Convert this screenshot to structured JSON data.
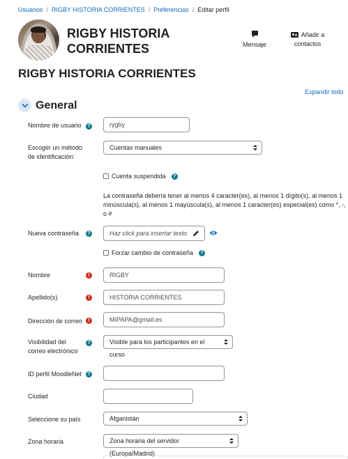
{
  "breadcrumb": [
    {
      "label": "Usuarios"
    },
    {
      "label": "RIGBY HISTORIA CORRIENTES"
    },
    {
      "label": "Preferencias"
    },
    {
      "label": "Editar perfil"
    }
  ],
  "breadcrumb_sep": "/",
  "header": {
    "name": "RIGBY HISTORIA CORRIENTES",
    "message_label": "Mensaje",
    "add_contact_label": "Añadir a contactos"
  },
  "page_title": "RIGBY HISTORIA CORRIENTES",
  "expand_all": "Expandir todo",
  "section": {
    "title": "General"
  },
  "form": {
    "username": {
      "label": "Nombre de usuario",
      "value": "rygby"
    },
    "auth": {
      "label": "Escoger un método de identificación:",
      "value": "Cuentas manuales"
    },
    "suspended": {
      "label": "Cuenta suspendida"
    },
    "password_hint": "La contraseña debería tener al menos 4 caracter(es), al menos 1 dígito(s), al menos 1 minúscula(s), al menos 1 mayúscula(s), al menos 1 caracter(es) especial(es) como *, -, o #",
    "new_password": {
      "label": "Nueva contraseña",
      "placeholder": "Haz click para insertar texto"
    },
    "force_change": {
      "label": "Forzar cambio de contraseña"
    },
    "firstname": {
      "label": "Nombre",
      "value": "RIGBY"
    },
    "lastname": {
      "label": "Apellido(s)",
      "value": "HISTORIA CORRIENTES"
    },
    "email": {
      "label": "Dirección de correo",
      "value": "MIPAPA@gmail.es"
    },
    "email_visibility": {
      "label": "Visibilidad del correo electrónico",
      "value": "Visible para los participantes en el curso"
    },
    "moodlenet": {
      "label": "ID perfil MoodleNet",
      "value": ""
    },
    "city": {
      "label": "Ciudad",
      "value": ""
    },
    "country": {
      "label": "Seleccione su país",
      "value": "Afganistán"
    },
    "timezone": {
      "label": "Zona horaria",
      "value": "Zona horaria del servidor (Europa/Madrid)"
    }
  },
  "icons": {
    "help": "?",
    "required": "!"
  },
  "colors": {
    "link": "#0f6cbf",
    "help": "#117a8b",
    "required": "#ca3120"
  }
}
